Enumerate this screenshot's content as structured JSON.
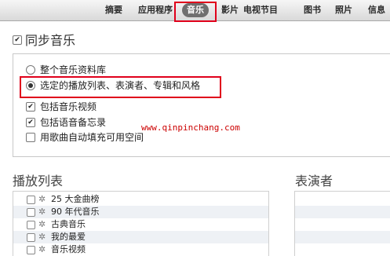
{
  "tabs": [
    {
      "label": "摘要"
    },
    {
      "label": "应用程序"
    },
    {
      "label": "音乐",
      "active": true
    },
    {
      "label": "影片"
    },
    {
      "label": "电视节目"
    },
    {
      "label": "图书"
    },
    {
      "label": "照片"
    },
    {
      "label": "信息"
    }
  ],
  "sync": {
    "label": "同步音乐",
    "checked": true
  },
  "options": {
    "entire_library": "整个音乐资料库",
    "selected": "选定的播放列表、表演者、专辑和风格",
    "include_videos": "包括音乐视频",
    "include_voice_memos": "包括语音备忘录",
    "autofill": "用歌曲自动填充可用空间"
  },
  "watermark": "www.qinpinchang.com",
  "playlists": {
    "title": "播放列表",
    "items": [
      "25 大金曲榜",
      "90 年代音乐",
      "古典音乐",
      "我的最爱",
      "音乐视频"
    ]
  },
  "artists": {
    "title": "表演者"
  },
  "colors": {
    "highlight": "#e0001b",
    "active_tab": "#6f6f6f"
  }
}
